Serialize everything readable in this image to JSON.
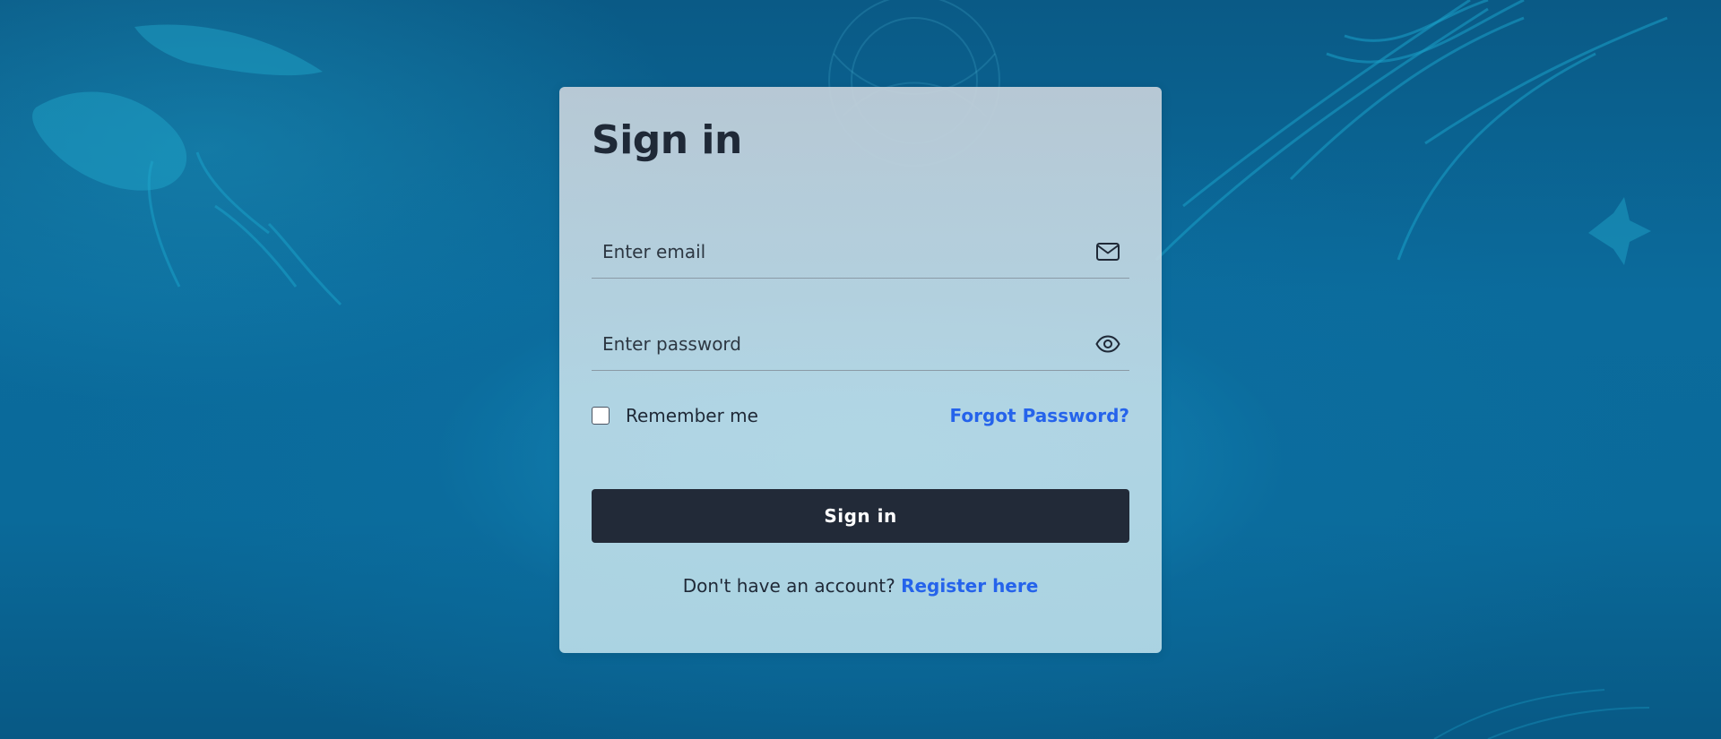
{
  "page": {
    "title": "Sign in"
  },
  "form": {
    "email": {
      "placeholder": "Enter email",
      "value": "",
      "icon": "envelope-icon"
    },
    "password": {
      "placeholder": "Enter password",
      "value": "",
      "icon": "eye-icon"
    },
    "remember": {
      "label": "Remember me",
      "checked": false
    },
    "forgot_label": "Forgot Password?",
    "submit_label": "Sign in",
    "register_prompt": "Don't have an account?",
    "register_link": "Register here"
  },
  "colors": {
    "accent": "#2563eb",
    "button": "#222a38",
    "text": "#1f2937"
  }
}
